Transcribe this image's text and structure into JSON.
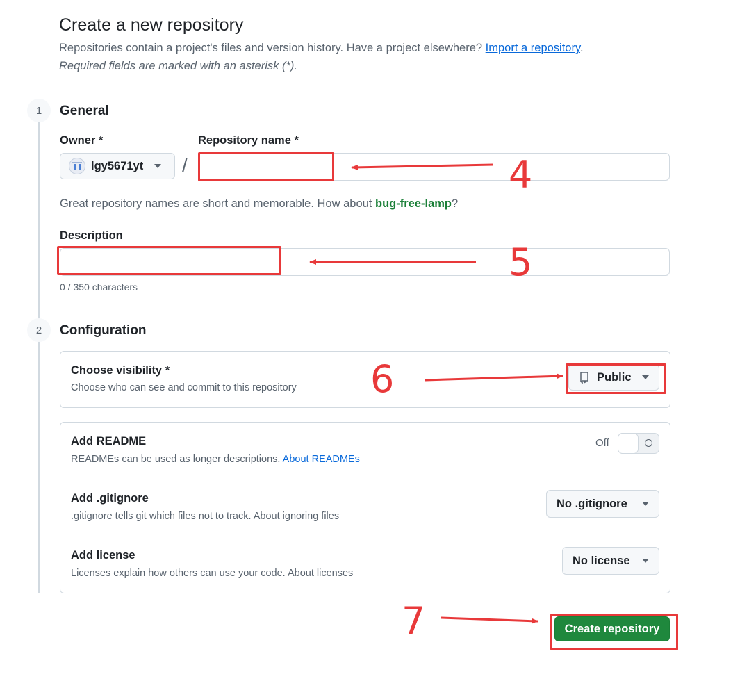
{
  "page": {
    "title": "Create a new repository",
    "subtitle": "Repositories contain a project's files and version history. Have a project elsewhere?",
    "import_link": "Import a repository",
    "subtitle_end": ".",
    "required_note": "Required fields are marked with an asterisk (*)."
  },
  "general": {
    "step": "1",
    "title": "General",
    "owner_label": "Owner *",
    "owner_value": "lgy5671yt",
    "separator": "/",
    "repo_name_label": "Repository name *",
    "repo_name_value": "",
    "name_hint_prefix": "Great repository names are short and memorable. How about",
    "name_suggestion": "bug-free-lamp",
    "name_hint_suffix": "?",
    "description_label": "Description",
    "description_value": "",
    "description_counter": "0 / 350 characters"
  },
  "configuration": {
    "step": "2",
    "title": "Configuration",
    "visibility": {
      "title": "Choose visibility *",
      "description": "Choose who can see and commit to this repository",
      "value": "Public"
    },
    "readme": {
      "title": "Add README",
      "description": "READMEs can be used as longer descriptions.",
      "link": "About READMEs",
      "toggle_label": "Off",
      "enabled": false
    },
    "gitignore": {
      "title": "Add .gitignore",
      "description": ".gitignore tells git which files not to track.",
      "link": "About ignoring files",
      "value": "No .gitignore"
    },
    "license": {
      "title": "Add license",
      "description": "Licenses explain how others can use your code.",
      "link": "About licenses",
      "value": "No license"
    }
  },
  "actions": {
    "create_label": "Create repository"
  },
  "annotations": {
    "color": "#e8393a",
    "labels": [
      "4",
      "5",
      "6",
      "7"
    ]
  }
}
